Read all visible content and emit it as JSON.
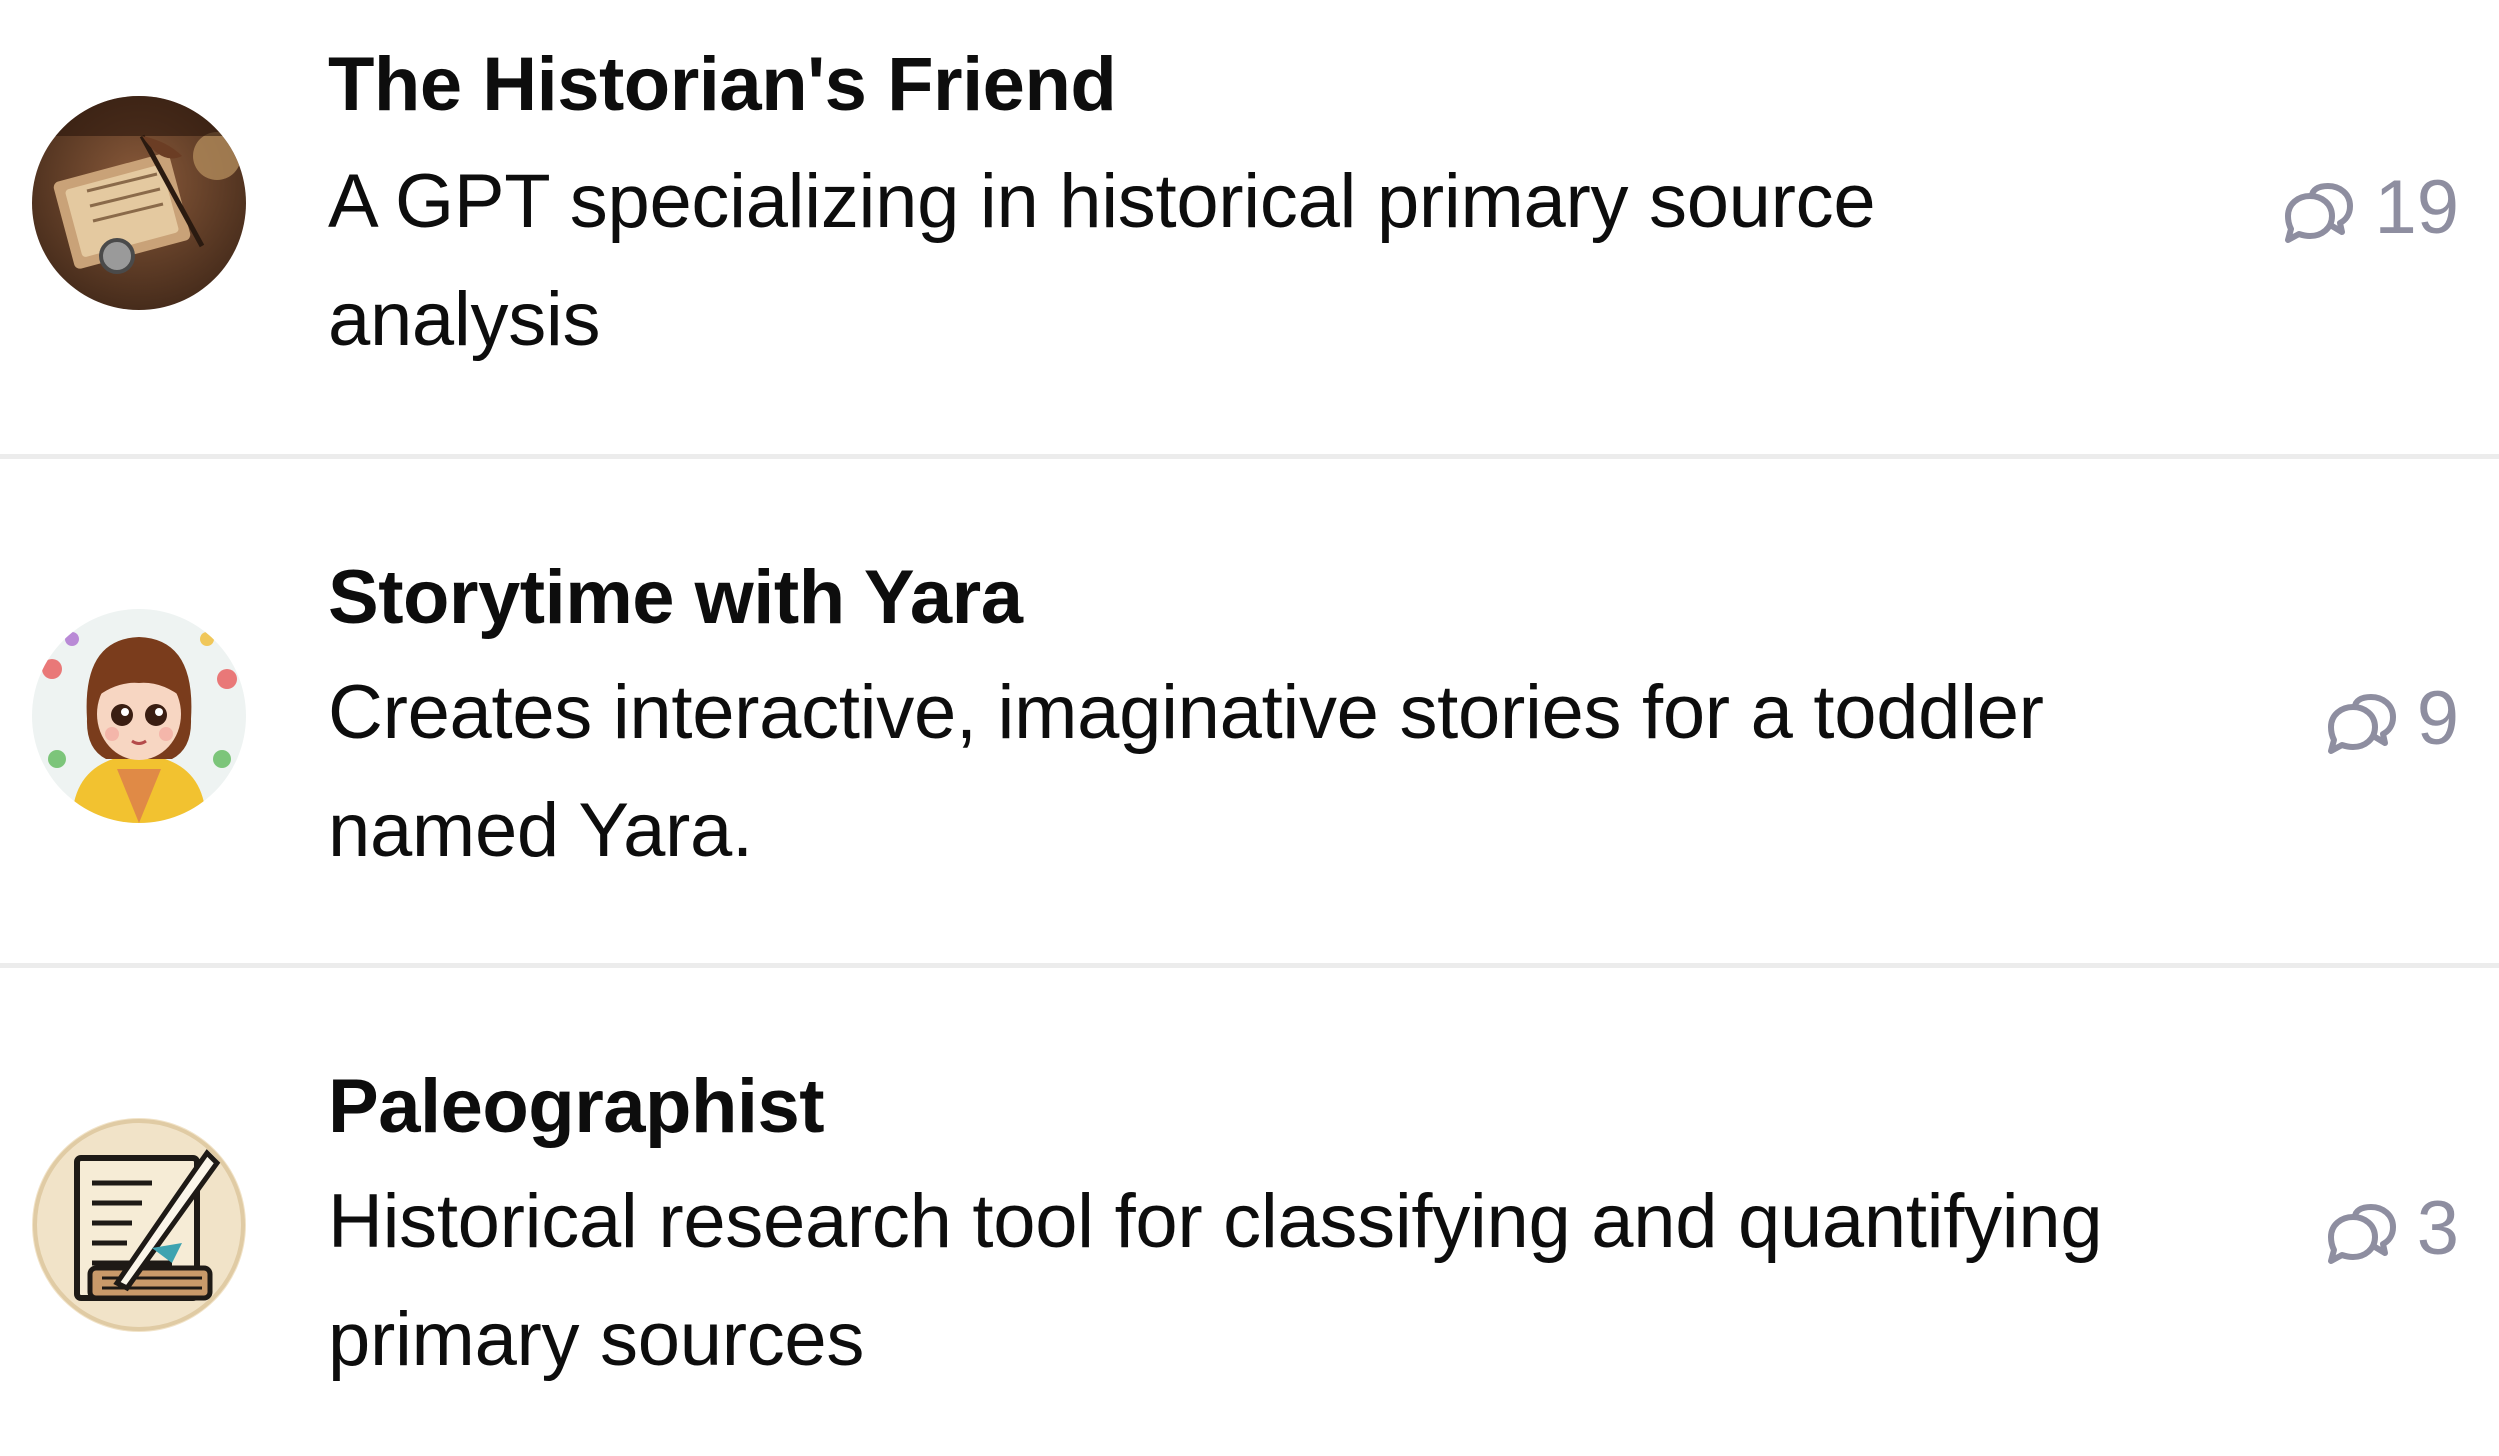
{
  "items": [
    {
      "title": "The Historian's Friend",
      "description": "A GPT specializing in historical primary source analysis",
      "count": "19",
      "avatar_icon": "historical-documents-icon"
    },
    {
      "title": "Storytime with Yara",
      "description": "Creates interactive, imaginative stories for a toddler named Yara.",
      "count": "9",
      "avatar_icon": "cartoon-girl-icon"
    },
    {
      "title": "Paleographist",
      "description": "Historical research tool for classifying and quantifying primary sources",
      "count": "3",
      "avatar_icon": "quill-manuscript-icon"
    }
  ],
  "icons": {
    "stat": "chat-bubbles-icon"
  },
  "colors": {
    "text": "#0d0d0d",
    "muted": "#8e8ea0",
    "divider": "#ececec",
    "background": "#ffffff"
  }
}
